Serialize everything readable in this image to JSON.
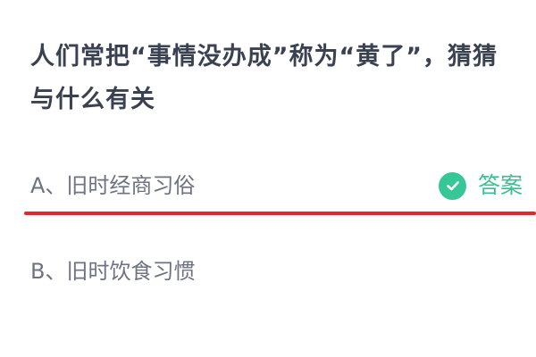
{
  "question": {
    "text": "人们常把“事情没办成”称为“黄了”，猜猜与什么有关"
  },
  "options": [
    {
      "label": "A、旧时经商习俗",
      "is_answer": true,
      "answer_label": "答案",
      "answer_icon": "check-icon"
    },
    {
      "label": "B、旧时饮食习惯",
      "is_answer": false
    }
  ],
  "colors": {
    "question_text": "#3a4150",
    "option_text": "#6d7380",
    "answer_green": "#34c290",
    "highlight_red": "#e3262b"
  }
}
